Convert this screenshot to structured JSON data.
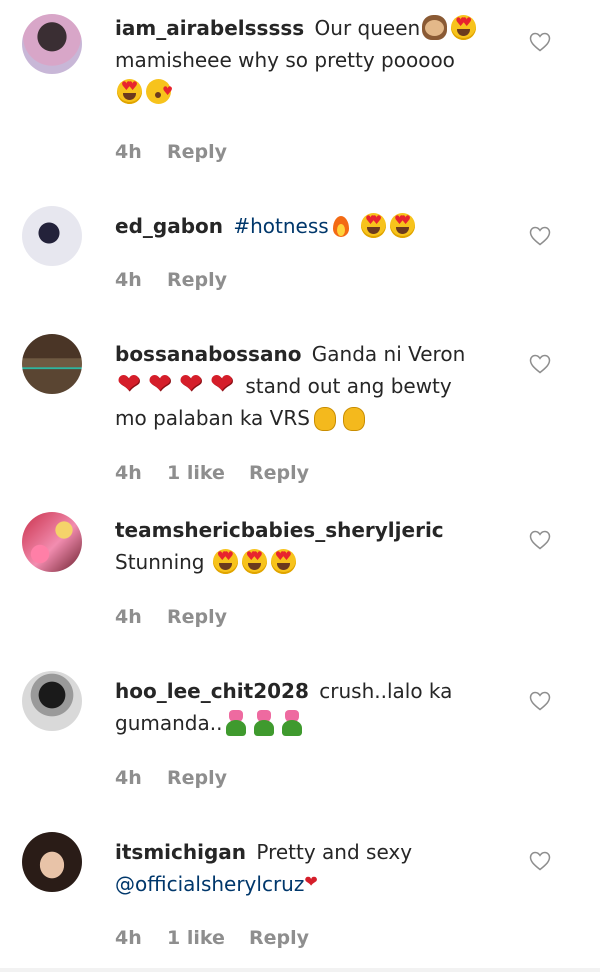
{
  "comments": [
    {
      "username": "iam_airabelsssss",
      "text_a": "Our queen",
      "text_b": "mamisheee why so pretty pooooo",
      "time": "4h",
      "reply": "Reply",
      "emojis": [
        "see-no-evil-monkey",
        "heart-eyes",
        "heart-eyes",
        "kissing-heart"
      ]
    },
    {
      "username": "ed_gabon",
      "hashtag": "#hotness",
      "time": "4h",
      "reply": "Reply",
      "emojis": [
        "fire",
        "heart-eyes",
        "heart-eyes"
      ]
    },
    {
      "username": "bossanabossano",
      "text_a": "Ganda ni Veron",
      "text_b": "stand out ang bewty",
      "text_c": "mo palaban ka VRS",
      "time": "4h",
      "likes": "1 like",
      "reply": "Reply",
      "emojis": [
        "red-heart",
        "red-heart",
        "red-heart",
        "red-heart",
        "clapping-hands",
        "clapping-hands"
      ]
    },
    {
      "username": "teamshericbabies_sheryljeric",
      "text_a": "Stunning",
      "time": "4h",
      "reply": "Reply",
      "emojis": [
        "heart-eyes",
        "heart-eyes",
        "heart-eyes"
      ]
    },
    {
      "username": "hoo_lee_chit2028",
      "text_a": "crush..lalo ka",
      "text_b": "gumanda..",
      "time": "4h",
      "reply": "Reply",
      "emojis": [
        "tulip",
        "tulip",
        "tulip"
      ]
    },
    {
      "username": "itsmichigan",
      "text_a": "Pretty and sexy",
      "mention": "@officialsherylcruz",
      "time": "4h",
      "likes": "1 like",
      "reply": "Reply",
      "emojis": [
        "red-heart"
      ]
    }
  ],
  "icons": {
    "like": "heart-outline-icon"
  },
  "colors": {
    "text": "#262626",
    "meta": "#8e8e8e",
    "mention": "#00376b"
  }
}
